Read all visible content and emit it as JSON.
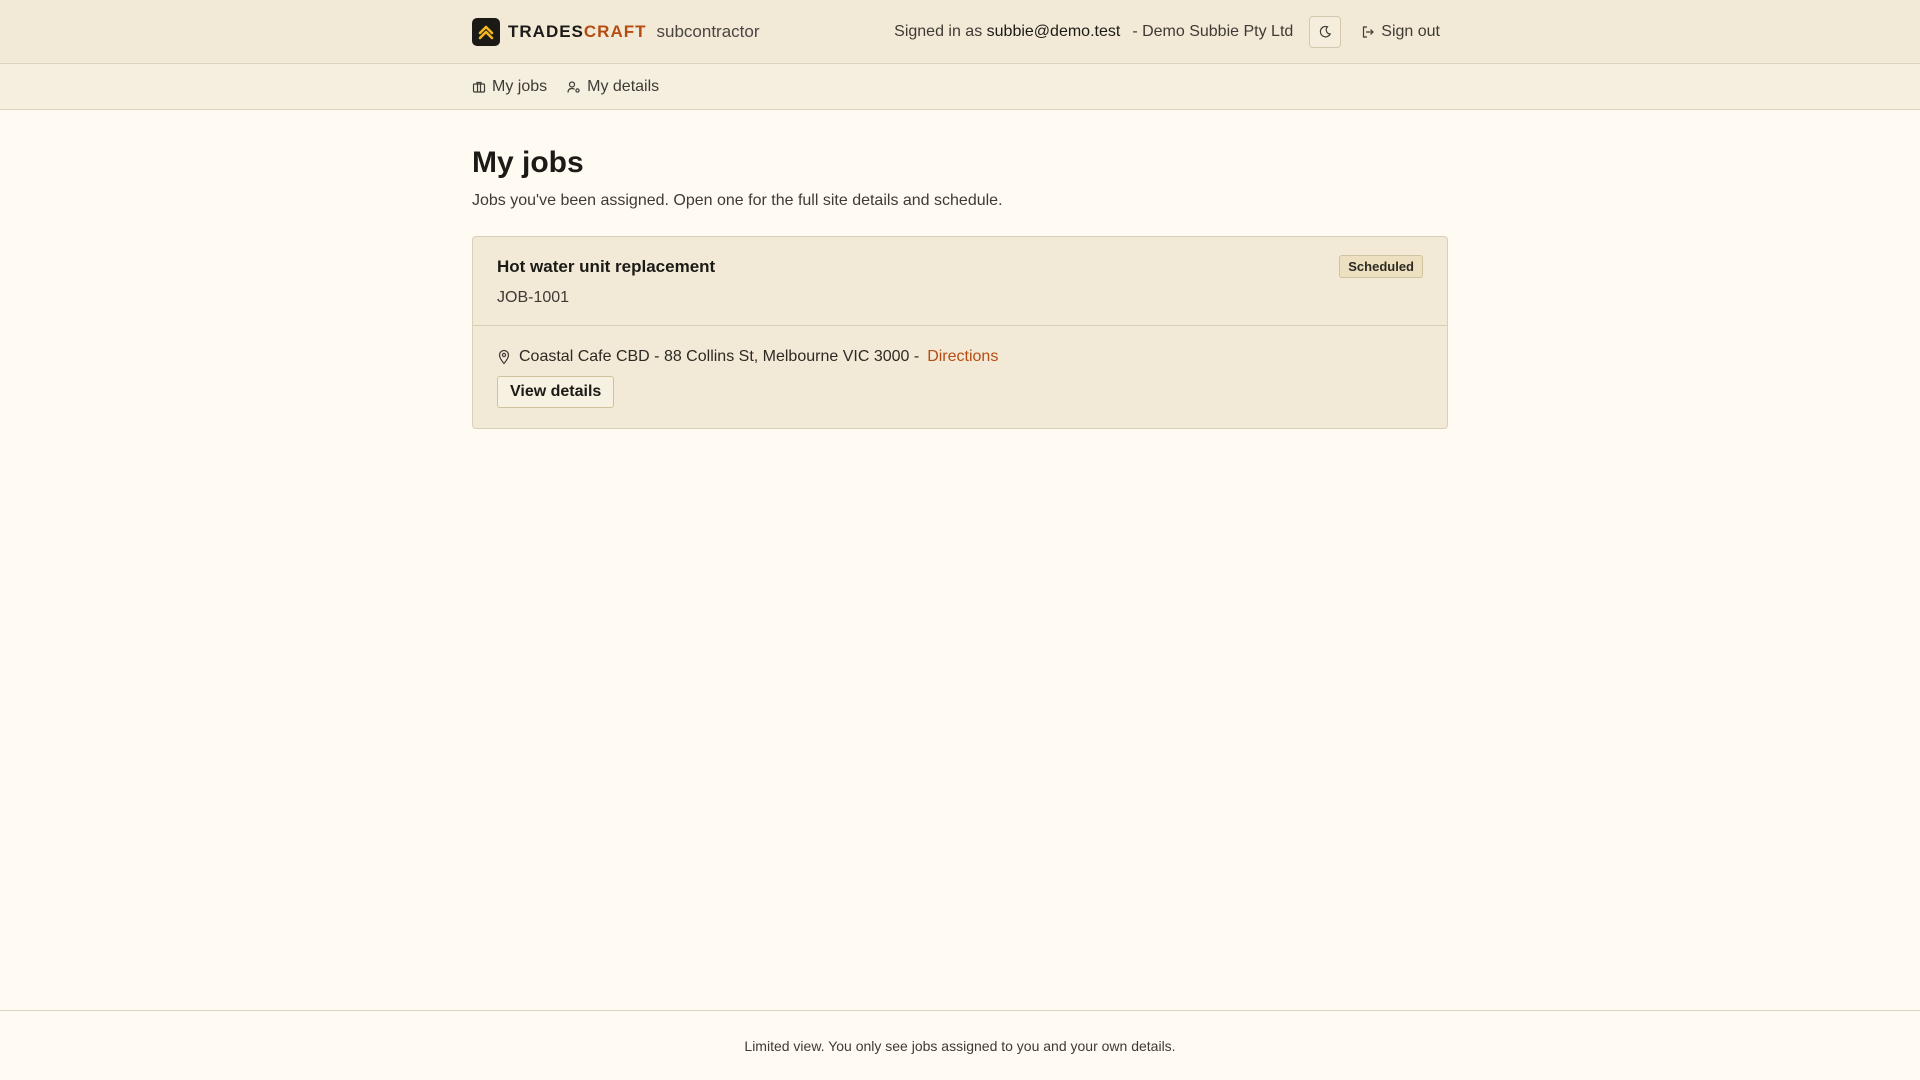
{
  "header": {
    "brand_trades": "TRADES",
    "brand_craft": "CRAFT",
    "brand_sub": "subcontractor",
    "signed_in_prefix": "Signed in as",
    "email": "subbie@demo.test",
    "company": "- Demo Subbie Pty Ltd",
    "sign_out_label": "Sign out"
  },
  "nav": {
    "items": [
      {
        "label": "My jobs",
        "icon": "briefcase-icon"
      },
      {
        "label": "My details",
        "icon": "user-gear-icon"
      }
    ]
  },
  "main": {
    "title": "My jobs",
    "subtitle": "Jobs you've been assigned. Open one for the full site details and schedule.",
    "jobs": [
      {
        "title": "Hot water unit replacement",
        "id": "JOB-1001",
        "status": "Scheduled",
        "location": "Coastal Cafe CBD - 88 Collins St, Melbourne VIC 3000 -",
        "directions_label": "Directions",
        "view_label": "View details"
      }
    ]
  },
  "footer": {
    "text": "Limited view. You only see jobs assigned to you and your own details."
  },
  "colors": {
    "accent": "#b54d12",
    "header_bg": "#f2ead7",
    "page_bg": "#fffbf2",
    "logo_bg": "#1c1a17",
    "logo_mark": "#f5b81c"
  }
}
